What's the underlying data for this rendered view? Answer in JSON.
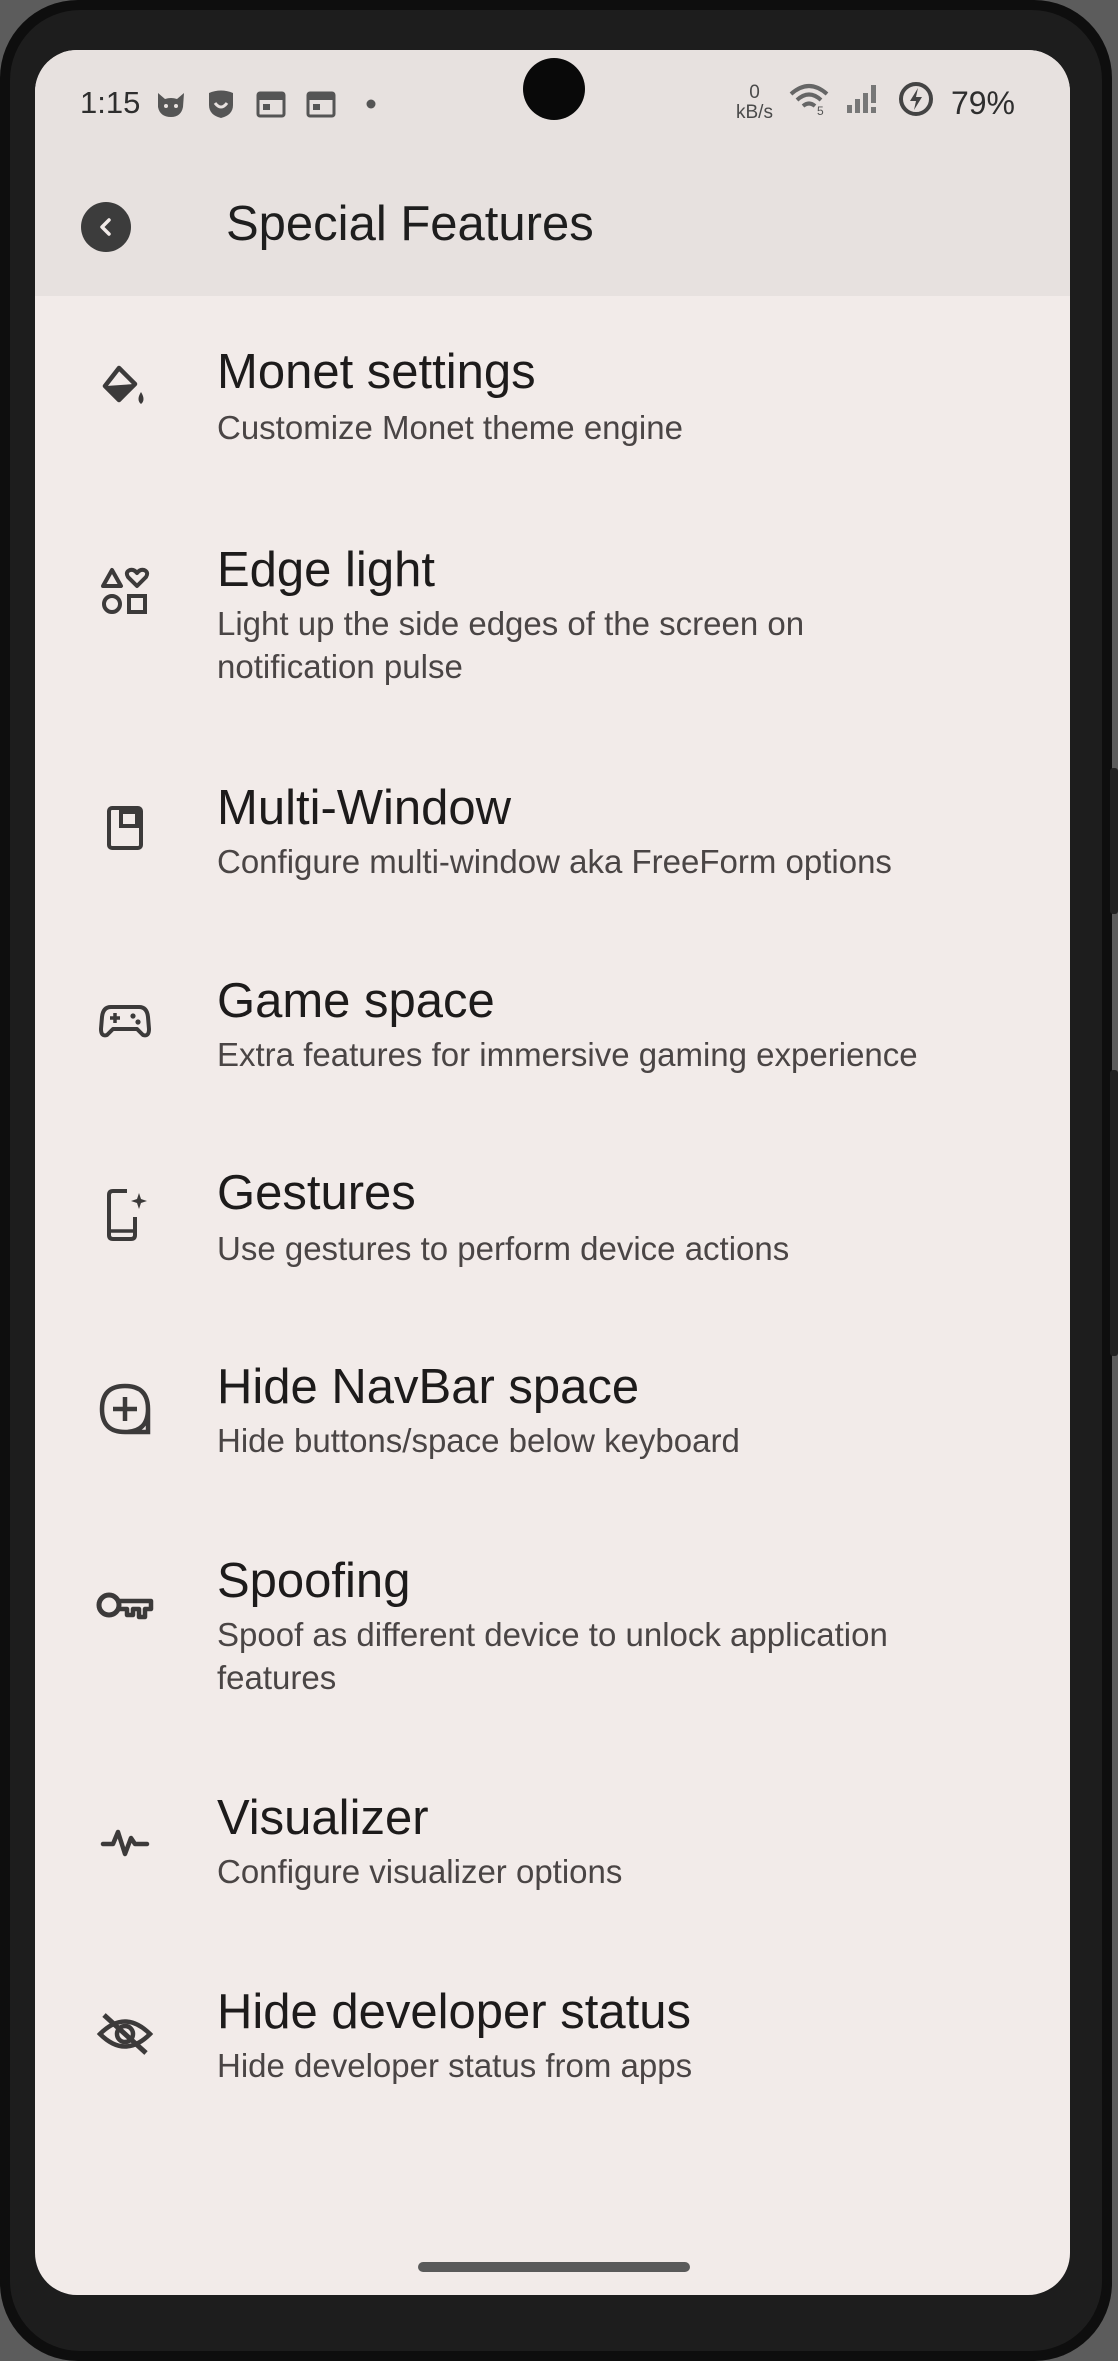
{
  "status_bar": {
    "time": "1:15",
    "net_speed_value": "0",
    "net_speed_unit": "kB/s",
    "battery": "79%"
  },
  "toolbar": {
    "title": "Special Features"
  },
  "items": [
    {
      "title": "Monet settings",
      "subtitle": "Customize Monet theme engine",
      "icon": "paint-bucket-icon"
    },
    {
      "title": "Edge light",
      "subtitle": "Light up the side edges of the screen on notification pulse",
      "icon": "shapes-icon"
    },
    {
      "title": "Multi-Window",
      "subtitle": "Configure multi-window aka FreeForm options",
      "icon": "picture-in-picture-icon"
    },
    {
      "title": "Game space",
      "subtitle": "Extra features for immersive gaming experience",
      "icon": "gamepad-icon"
    },
    {
      "title": "Gestures",
      "subtitle": "Use gestures to perform device actions",
      "icon": "phone-sparkle-icon"
    },
    {
      "title": "Hide NavBar space",
      "subtitle": "Hide buttons/space below keyboard",
      "icon": "add-circle-icon"
    },
    {
      "title": "Spoofing",
      "subtitle": "Spoof as different device to unlock application features",
      "icon": "key-icon"
    },
    {
      "title": "Visualizer",
      "subtitle": "Configure visualizer options",
      "icon": "pulse-icon"
    },
    {
      "title": "Hide developer status",
      "subtitle": "Hide developer status from apps",
      "icon": "eye-off-icon"
    }
  ]
}
